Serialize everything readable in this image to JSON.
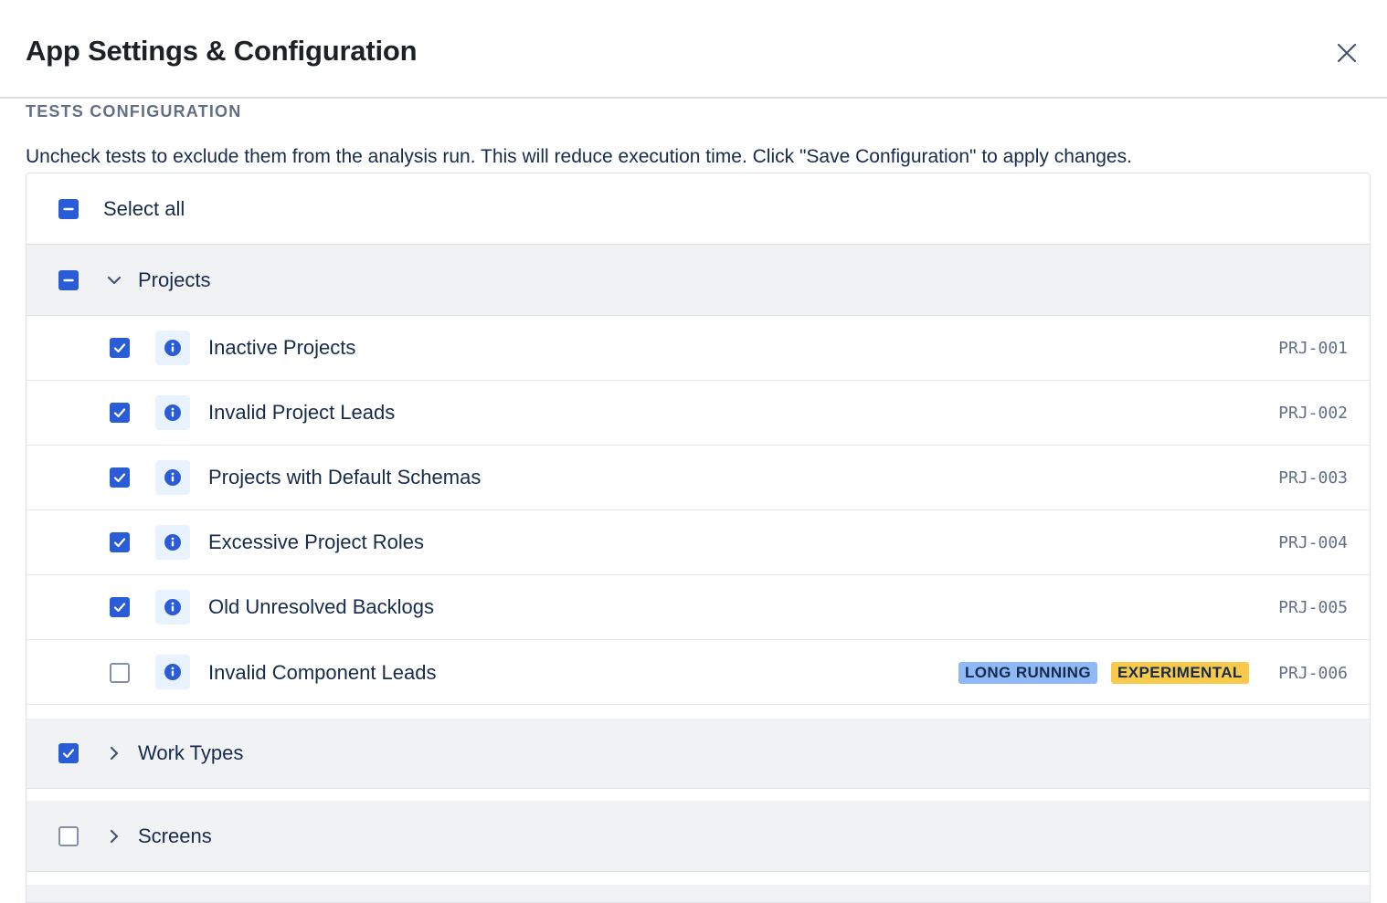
{
  "modal": {
    "title": "App Settings & Configuration",
    "close_icon": "close-icon"
  },
  "section": {
    "heading": "TESTS CONFIGURATION",
    "description": "Uncheck tests to exclude them from the analysis run. This will reduce execution time. Click \"Save Configuration\" to apply changes."
  },
  "select_all": {
    "label": "Select all",
    "state": "indeterminate"
  },
  "groups": [
    {
      "label": "Projects",
      "state": "indeterminate",
      "expanded": true,
      "tests": [
        {
          "label": "Inactive Projects",
          "code": "PRJ-001",
          "checked": true,
          "badges": []
        },
        {
          "label": "Invalid Project Leads",
          "code": "PRJ-002",
          "checked": true,
          "badges": []
        },
        {
          "label": "Projects with Default Schemas",
          "code": "PRJ-003",
          "checked": true,
          "badges": []
        },
        {
          "label": "Excessive Project Roles",
          "code": "PRJ-004",
          "checked": true,
          "badges": []
        },
        {
          "label": "Old Unresolved Backlogs",
          "code": "PRJ-005",
          "checked": true,
          "badges": []
        },
        {
          "label": "Invalid Component Leads",
          "code": "PRJ-006",
          "checked": false,
          "badges": [
            "LONG RUNNING",
            "EXPERIMENTAL"
          ]
        }
      ]
    },
    {
      "label": "Work Types",
      "state": "checked",
      "expanded": false
    },
    {
      "label": "Screens",
      "state": "unchecked",
      "expanded": false
    }
  ],
  "colors": {
    "accent": "#2a5cd7",
    "group_background": "#f1f2f4",
    "badge_long_running": "#8fb8f6",
    "badge_experimental": "#f8c94a"
  }
}
